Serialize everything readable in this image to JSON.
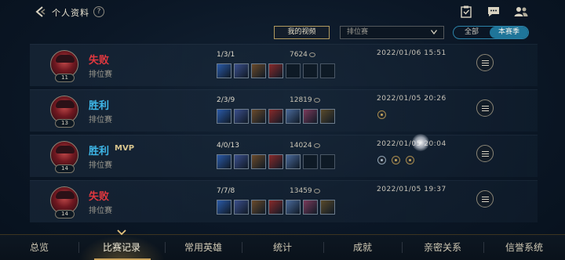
{
  "header": {
    "title": "个人资料",
    "help": "?",
    "icons": [
      "back-icon",
      "checklist-icon",
      "message-icon",
      "friends-icon"
    ]
  },
  "filters": {
    "my_videos": "我的视频",
    "mode_selected": "排位赛",
    "season_all": "全部",
    "season_current": "本赛季"
  },
  "matches": [
    {
      "result": "失败",
      "outcome": "loss",
      "mvp": "",
      "queue": "排位赛",
      "level": "11",
      "kda": "1/3/1",
      "gold": "7624",
      "items_filled": 4,
      "datetime": "2022/01/06 15:51",
      "badges": 0
    },
    {
      "result": "胜利",
      "outcome": "win",
      "mvp": "",
      "queue": "排位赛",
      "level": "13",
      "kda": "2/3/9",
      "gold": "12819",
      "items_filled": 7,
      "datetime": "2022/01/05 20:26",
      "badges": 1
    },
    {
      "result": "胜利",
      "outcome": "win",
      "mvp": "MVP",
      "queue": "排位赛",
      "level": "14",
      "kda": "4/0/13",
      "gold": "14024",
      "items_filled": 5,
      "datetime": "2022/01/05 20:04",
      "badges": 3
    },
    {
      "result": "失败",
      "outcome": "loss",
      "mvp": "",
      "queue": "排位赛",
      "level": "14",
      "kda": "7/7/8",
      "gold": "13459",
      "items_filled": 7,
      "datetime": "2022/01/05 19:37",
      "badges": 0
    }
  ],
  "bottom_nav": [
    "总览",
    "比赛记录",
    "常用英雄",
    "统计",
    "成就",
    "亲密关系",
    "信誉系统"
  ],
  "active_tab": "比赛记录",
  "colors": {
    "loss": "#e0383f",
    "win": "#3eb7e8",
    "gold_accent": "#c9a25b",
    "toggle": "#1f7599"
  }
}
